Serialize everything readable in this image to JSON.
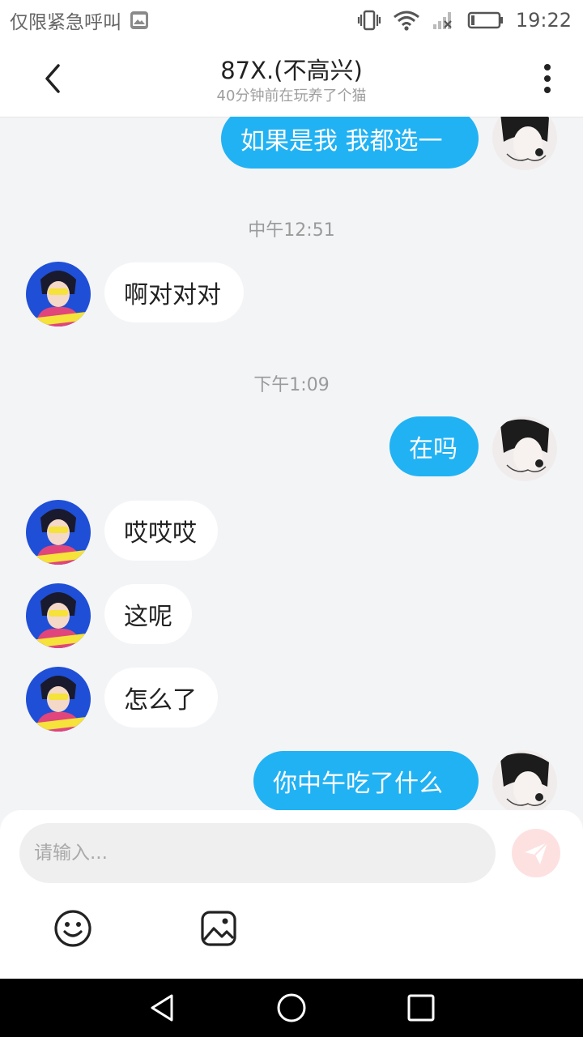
{
  "status_bar": {
    "emergency_text": "仅限紧急呼叫",
    "time": "19:22"
  },
  "header": {
    "title": "87X.(不高兴)",
    "subtitle": "40分钟前在玩养了个猫"
  },
  "messages": [
    {
      "type": "text",
      "side": "out",
      "text": "如果是我 我都选一"
    },
    {
      "type": "timestamp",
      "text": "中午12:51"
    },
    {
      "type": "text",
      "side": "in",
      "text": "啊对对对"
    },
    {
      "type": "timestamp",
      "text": "下午1:09"
    },
    {
      "type": "text",
      "side": "out",
      "text": "在吗"
    },
    {
      "type": "text",
      "side": "in",
      "text": "哎哎哎"
    },
    {
      "type": "text",
      "side": "in",
      "text": "这呢"
    },
    {
      "type": "text",
      "side": "in",
      "text": "怎么了"
    },
    {
      "type": "text",
      "side": "out",
      "text": "你中午吃了什么"
    }
  ],
  "input": {
    "placeholder": "请输入...",
    "value": ""
  },
  "icons": {
    "back": "chevron-left-icon",
    "menu": "more-vertical-icon",
    "send": "send-icon",
    "emoji": "emoji-icon",
    "image": "image-icon"
  },
  "colors": {
    "outgoing_bubble": "#21b2f4",
    "incoming_bubble": "#ffffff",
    "background": "#f3f4f6",
    "send_button": "#fde1e1"
  }
}
